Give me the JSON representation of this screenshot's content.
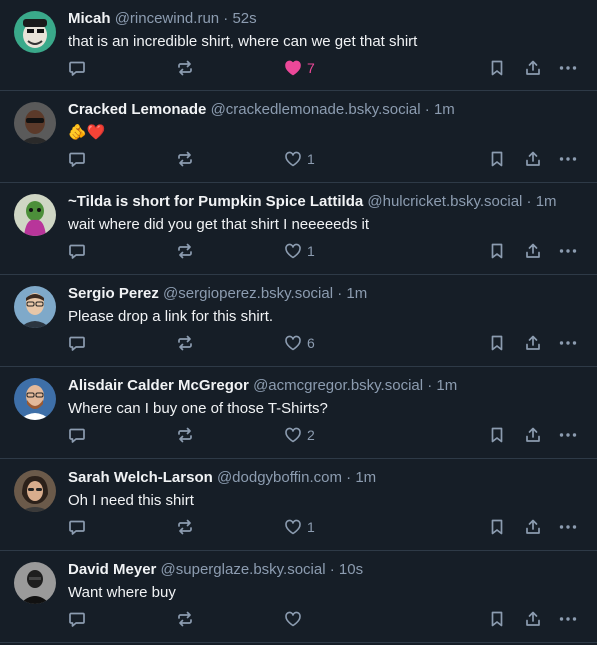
{
  "posts": [
    {
      "name": "Micah",
      "handle": "@rincewind.run",
      "separator": "·",
      "time": "52s",
      "text": "that is an incredible shirt, where can we get that shirt",
      "likes": "7",
      "liked": true,
      "avatar_icon": "cartoon-avatar-icon"
    },
    {
      "name": "Cracked Lemonade",
      "handle": "@crackedlemonade.bsky.social",
      "separator": "·",
      "time": "1m",
      "text": "🫵❤️",
      "likes": "1",
      "liked": false,
      "avatar_icon": "person-avatar-icon"
    },
    {
      "name": "~Tilda is short for Pumpkin Spice Lattilda",
      "handle": "@hulcricket.bsky.social",
      "separator": "·",
      "time": "1m",
      "text": "wait where did you get that shirt I neeeeeds it",
      "likes": "1",
      "liked": false,
      "avatar_icon": "cartoon-avatar-icon"
    },
    {
      "name": "Sergio Perez",
      "handle": "@sergioperez.bsky.social",
      "separator": "·",
      "time": "1m",
      "text": "Please drop a link for this shirt.",
      "likes": "6",
      "liked": false,
      "avatar_icon": "person-avatar-icon"
    },
    {
      "name": "Alisdair Calder McGregor",
      "handle": "@acmcgregor.bsky.social",
      "separator": "·",
      "time": "1m",
      "text": "Where can I buy one of those T-Shirts?",
      "likes": "2",
      "liked": false,
      "avatar_icon": "person-avatar-icon"
    },
    {
      "name": "Sarah Welch-Larson",
      "handle": "@dodgyboffin.com",
      "separator": "·",
      "time": "1m",
      "text": "Oh I need this shirt",
      "likes": "1",
      "liked": false,
      "avatar_icon": "person-avatar-icon"
    },
    {
      "name": "David Meyer",
      "handle": "@superglaze.bsky.social",
      "separator": "·",
      "time": "10s",
      "text": "Want where buy",
      "likes": "",
      "liked": false,
      "avatar_icon": "person-avatar-icon"
    }
  ],
  "colors": {
    "background": "#161e27",
    "divider": "#2e3a47",
    "muted": "#8c9cb0",
    "text": "#f1f3f5",
    "like_active": "#ec4899"
  },
  "icons": {
    "reply": "reply-icon",
    "repost": "repost-icon",
    "like": "heart-icon",
    "bookmark": "bookmark-icon",
    "share": "share-icon",
    "more": "more-options-icon"
  }
}
